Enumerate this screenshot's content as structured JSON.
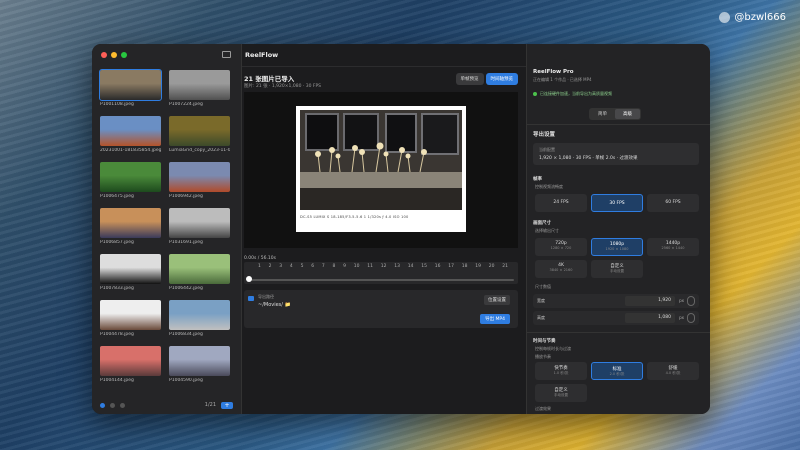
{
  "watermark": "@bzwl666",
  "app": {
    "title": "ReelFlow"
  },
  "sidebar": {
    "items": [
      {
        "name": "P1001108.jpeg",
        "c1": "#8a7a62",
        "c2": "#2a2a2a"
      },
      {
        "name": "P1007224.jpeg",
        "c1": "#9a9a9a",
        "c2": "#505050"
      },
      {
        "name": "20231001-181835854.jpeg",
        "c1": "#6a8fc4",
        "c2": "#b4532a"
      },
      {
        "name": "LumiaGrid_copy_2023-11-0...",
        "c1": "#7a6a2a",
        "c2": "#3c4a2a"
      },
      {
        "name": "P1006475.jpeg",
        "c1": "#4a8a3a",
        "c2": "#1d4a1d"
      },
      {
        "name": "P1006942.jpeg",
        "c1": "#7b8ab0",
        "c2": "#b04a2a"
      },
      {
        "name": "P1006857.jpeg",
        "c1": "#c8905a",
        "c2": "#3a3a5a"
      },
      {
        "name": "P1031691.jpeg",
        "c1": "#bcbcbc",
        "c2": "#444"
      },
      {
        "name": "P1007833.jpeg",
        "c1": "#ddd",
        "c2": "#111"
      },
      {
        "name": "P1006442.jpeg",
        "c1": "#9ac07a",
        "c2": "#4a6a3a"
      },
      {
        "name": "P1004478.jpeg",
        "c1": "#eee",
        "c2": "#6a4a3a"
      },
      {
        "name": "P1006834.jpeg",
        "c1": "#7aa0c4",
        "c2": "#c0c0c0"
      },
      {
        "name": "P1004144.jpeg",
        "c1": "#d8706a",
        "c2": "#5a3a3a"
      },
      {
        "name": "P1004590.jpeg",
        "c1": "#a0a8c0",
        "c2": "#4a4a5a"
      }
    ],
    "count": "1/21"
  },
  "header": {
    "title": "21 张图片已导入",
    "info": "图片: 21 张 · 1,920×1,080 · 30 FPS",
    "seg": [
      "单帧预览",
      "时间轴预览"
    ]
  },
  "preview": {
    "exif": "DC-S5   LUMIX S 18-185/F3.5-5.6   1 1/320s   ƒ 4.0   ISO 100"
  },
  "timeline": {
    "time": "0.00s / 56.10s",
    "ticks": [
      "1",
      "2",
      "3",
      "4",
      "5",
      "6",
      "7",
      "8",
      "9",
      "10",
      "11",
      "12",
      "13",
      "14",
      "15",
      "16",
      "17",
      "18",
      "19",
      "20",
      "21"
    ]
  },
  "export": {
    "label": "导出路径",
    "path": "~/Movies/ 📁",
    "btn_settings": "位置设置",
    "btn_export": "导出 MP4"
  },
  "right": {
    "title": "ReelFlow Pro",
    "subtitle": "正在编辑 1 个作品 · 已选择 MP4",
    "status": "已连接硬件加速，当前导出为高质量视频",
    "mode_tabs": [
      "简单",
      "高级"
    ],
    "export_settings": "导出设置",
    "summary_label": "当前配置",
    "summary": "1,920 × 1,080 · 30 FPS · 单帧 2.0s · 过渡效果",
    "fps_title": "帧率",
    "fps_sub": "控制视频流畅度",
    "fps": [
      "24 FPS",
      "30 FPS",
      "60 FPS"
    ],
    "size_title": "画面尺寸",
    "size_sub": "选择输出尺寸",
    "sizes": [
      {
        "t": "720p",
        "s": "1280 × 720"
      },
      {
        "t": "1080p",
        "s": "1920 × 1080"
      },
      {
        "t": "1440p",
        "s": "2560 × 1440"
      },
      {
        "t": "4K",
        "s": "3840 × 2160"
      },
      {
        "t": "自定义",
        "s": "手动设置"
      }
    ],
    "custom_label": "尺寸数值",
    "width_label": "宽度",
    "width": "1,920",
    "height_label": "高度",
    "height": "1,080",
    "unit": "px",
    "timing_title": "时间与节奏",
    "timing_sub": "控制每帧时长与过渡",
    "pace_label": "播放节奏",
    "paces": [
      {
        "t": "快节奏",
        "s": "1.0 秒/张"
      },
      {
        "t": "标准",
        "s": "2.0 秒/张"
      },
      {
        "t": "舒缓",
        "s": "4.0 秒/张"
      },
      {
        "t": "自定义",
        "s": "手动设置"
      }
    ],
    "bottom_label": "过渡效果"
  },
  "colors": {
    "accent": "#2f7de1"
  }
}
